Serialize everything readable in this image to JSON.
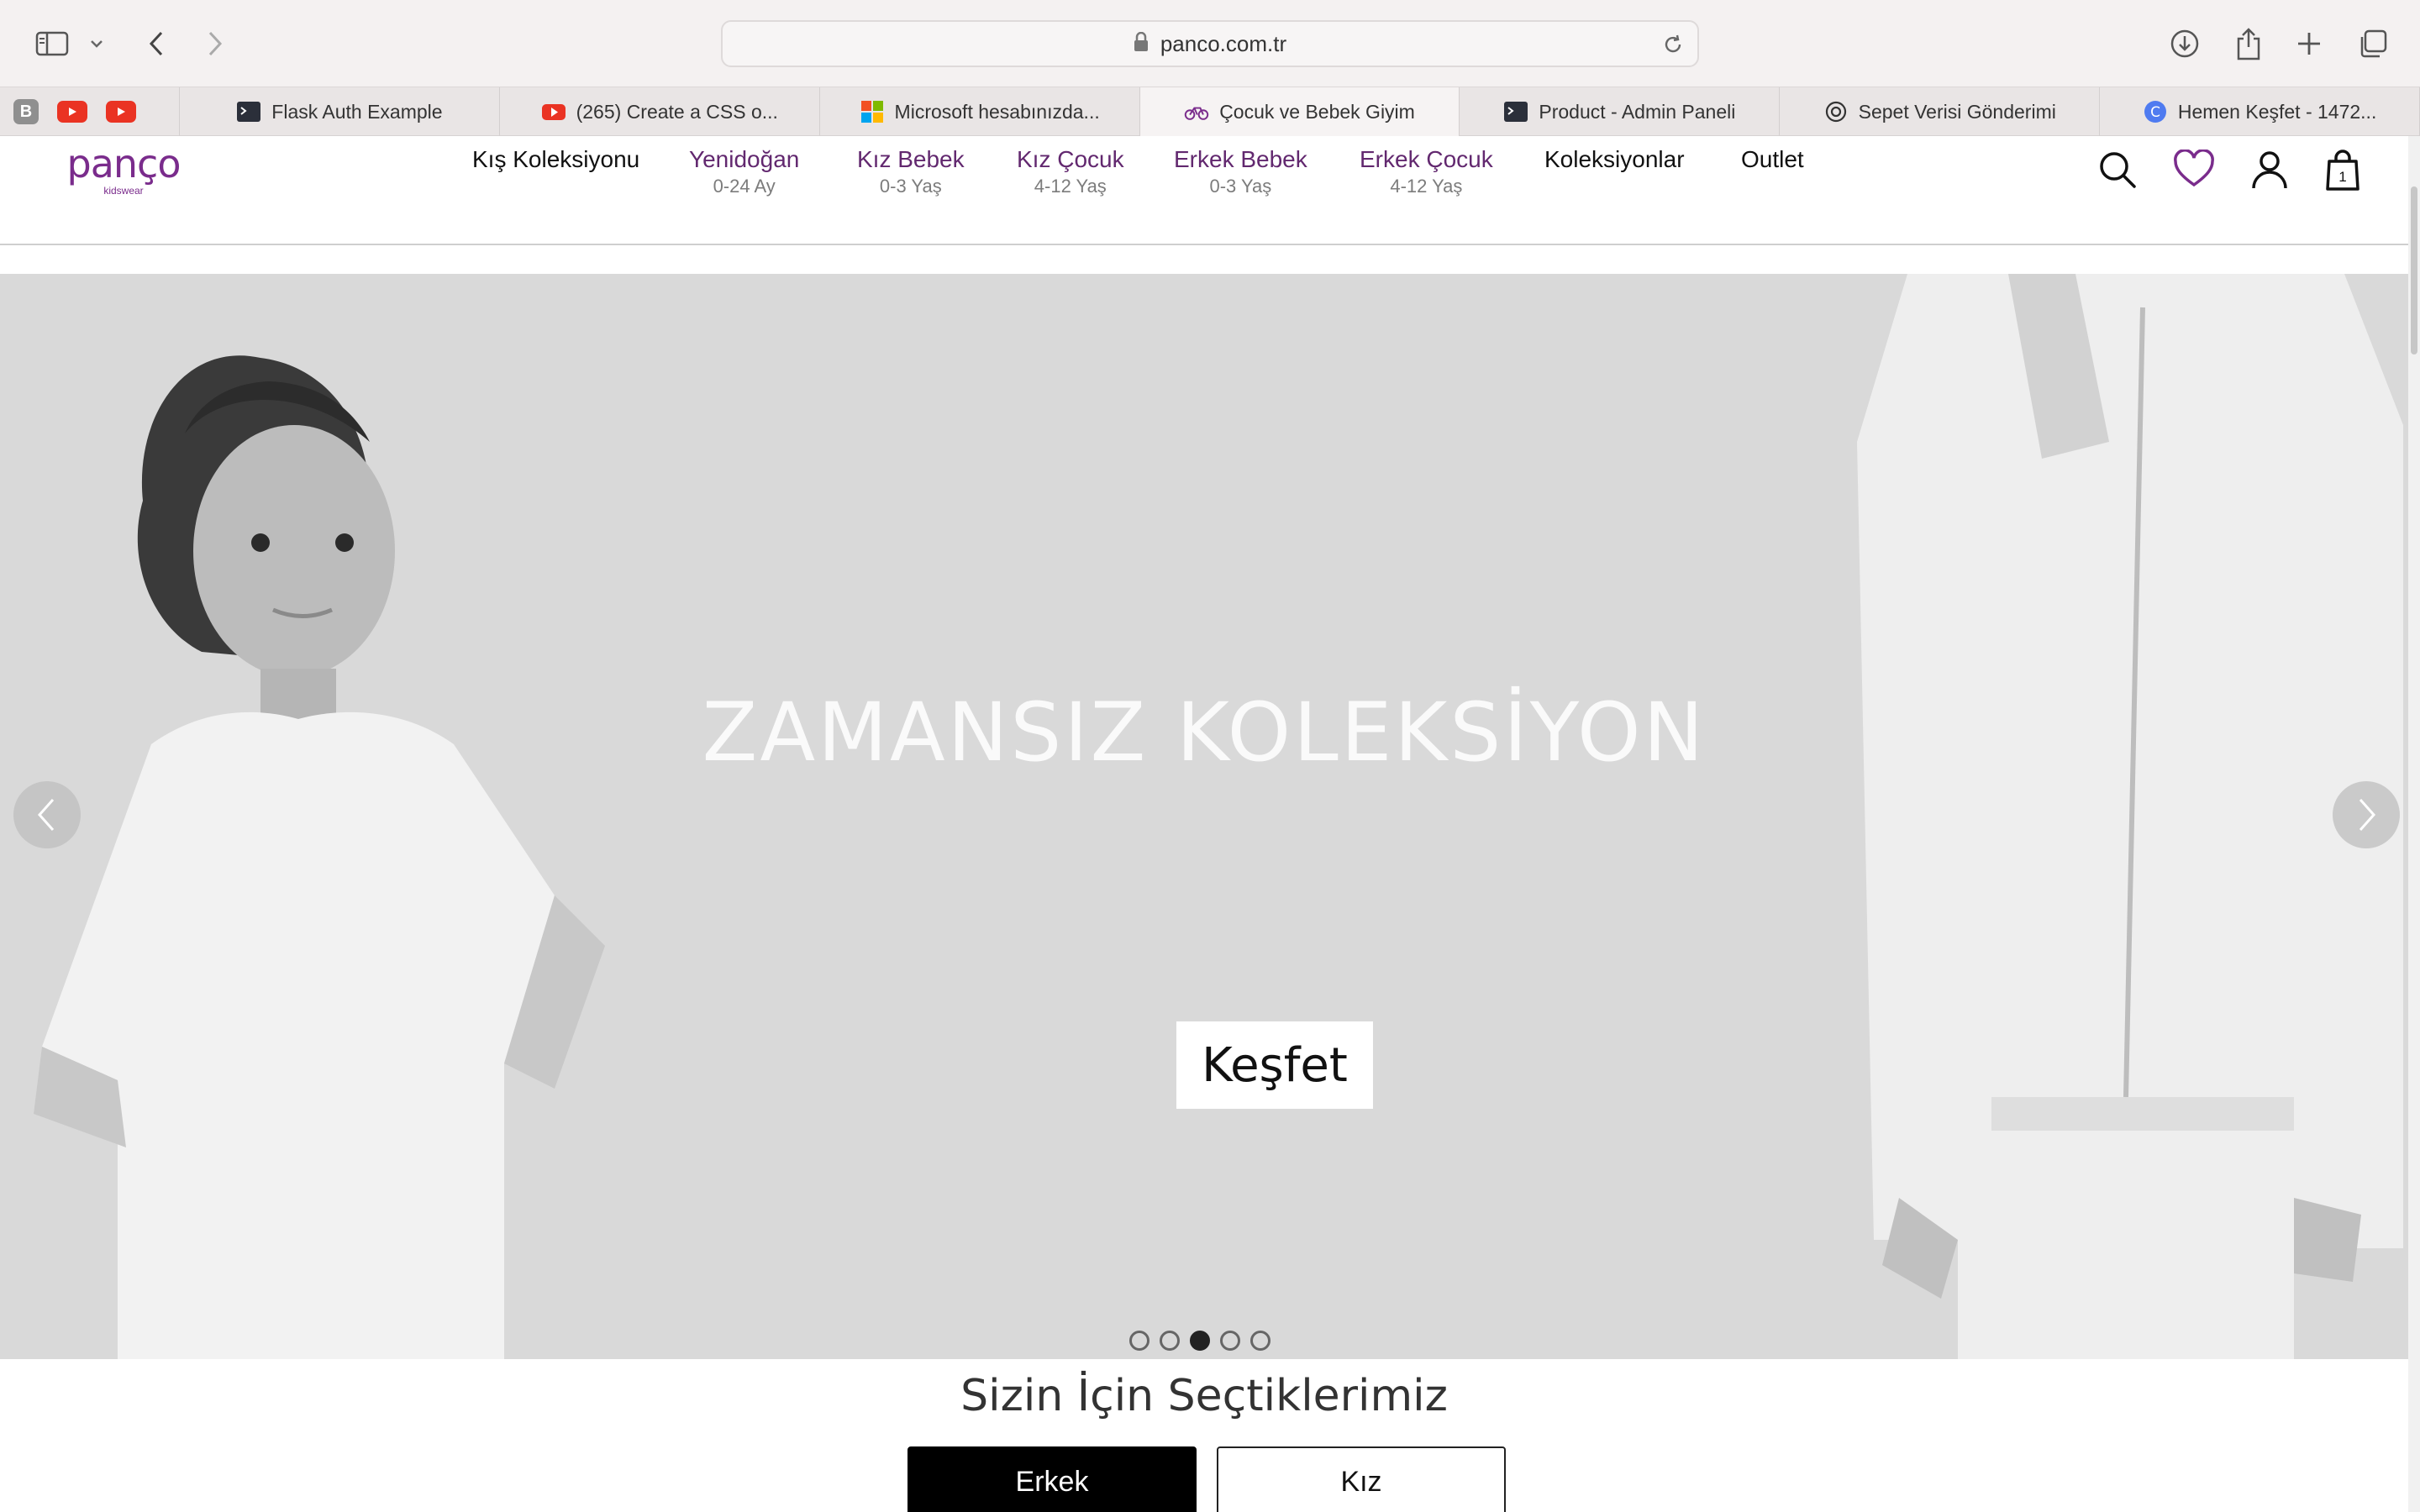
{
  "browser": {
    "url": "panco.com.tr",
    "pinned_tabs": [
      {
        "icon": "b-letter-icon",
        "label": "B"
      },
      {
        "icon": "youtube-icon"
      },
      {
        "icon": "youtube-icon"
      }
    ],
    "tabs": [
      {
        "title": "Flask Auth Example",
        "icon": "terminal-icon"
      },
      {
        "title": "(265) Create a CSS o...",
        "icon": "youtube-icon"
      },
      {
        "title": "Microsoft hesabınızda...",
        "icon": "microsoft-icon"
      },
      {
        "title": "Çocuk ve Bebek Giyim",
        "icon": "bicycle-icon",
        "active": true
      },
      {
        "title": "Product - Admin Paneli",
        "icon": "terminal-icon"
      },
      {
        "title": "Sepet Verisi Gönderimi",
        "icon": "openai-icon"
      },
      {
        "title": "Hemen Keşfet - 1472...",
        "icon": "c-logo-icon"
      }
    ]
  },
  "site": {
    "logo": {
      "brand": "panço",
      "sub": "kidswear"
    },
    "nav": [
      {
        "label": "Kış Koleksiyonu",
        "sub": "",
        "style": "dark"
      },
      {
        "label": "Yenidoğan",
        "sub": "0-24 Ay",
        "style": "purple"
      },
      {
        "label": "Kız Bebek",
        "sub": "0-3 Yaş",
        "style": "purple"
      },
      {
        "label": "Kız Çocuk",
        "sub": "4-12 Yaş",
        "style": "purple"
      },
      {
        "label": "Erkek Bebek",
        "sub": "0-3 Yaş",
        "style": "purple"
      },
      {
        "label": "Erkek Çocuk",
        "sub": "4-12 Yaş",
        "style": "purple"
      },
      {
        "label": "Koleksiyonlar",
        "sub": "",
        "style": "dark"
      },
      {
        "label": "Outlet",
        "sub": "",
        "style": "dark"
      }
    ],
    "header_icons": [
      "search-icon",
      "heart-icon",
      "user-icon",
      "shopping-bag-icon"
    ],
    "cart_count": "1",
    "accent_color": "#7a2c8c"
  },
  "hero": {
    "title": "ZAMANSIZ KOLEKSİYON",
    "cta": "Keşfet",
    "slide_count": 5,
    "active_slide": 3
  },
  "picks": {
    "title": "Sizin İçin Seçtiklerimiz",
    "buttons": [
      "Erkek",
      "Kız"
    ]
  }
}
